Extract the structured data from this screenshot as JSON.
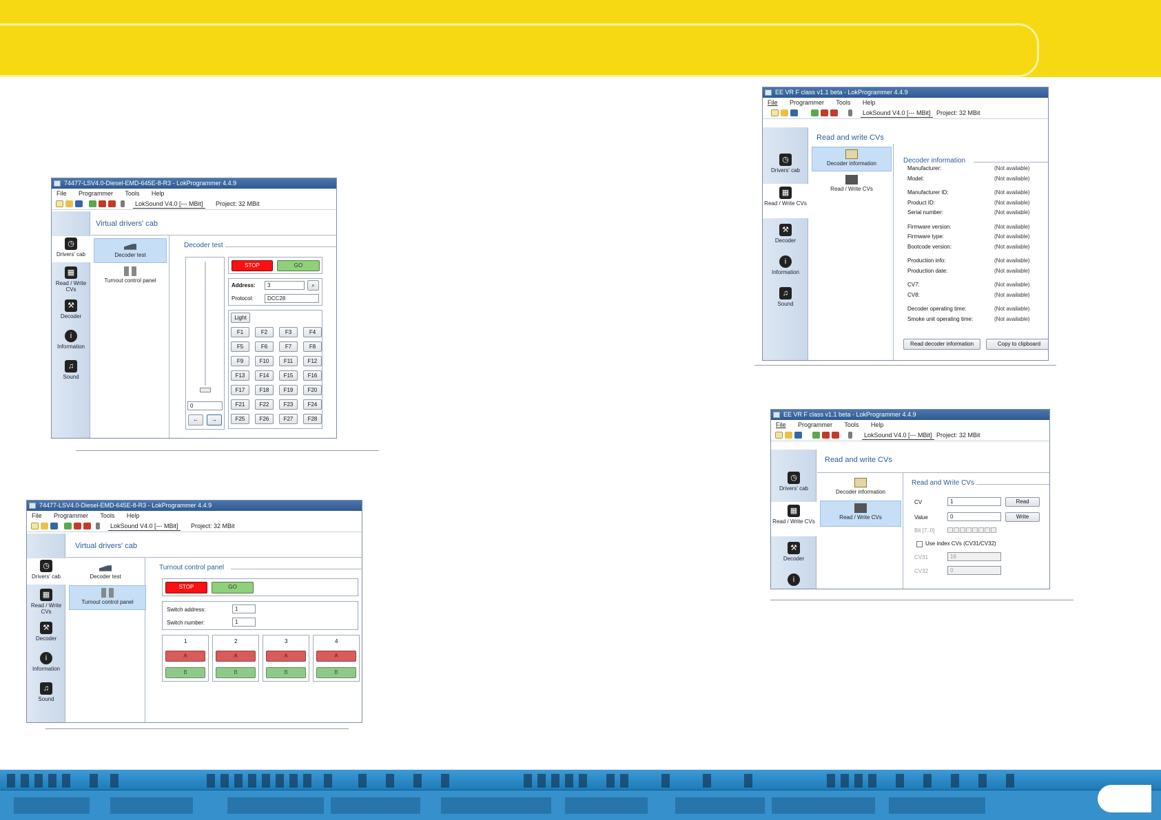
{
  "colors": {
    "banner": "#f6d912",
    "footer": "#2a86c2",
    "titlebar": "#3a659c",
    "stop": "#ff1010",
    "go": "#8fd07a"
  },
  "common": {
    "menu": [
      "File",
      "Programmer",
      "Tools",
      "Help"
    ],
    "decoder_combo": "LokSound V4.0 [--- MBit]",
    "project": "Project:  32 MBit",
    "nav": {
      "drivers_cab": "Drivers' cab",
      "read_write": "Read / Write CVs",
      "decoder": "Decoder",
      "information": "Information",
      "sound": "Sound"
    },
    "icons": [
      "new-icon",
      "open-icon",
      "save-icon",
      "read-icon",
      "write-icon",
      "play-icon",
      "wand-icon",
      "stopwatch-icon",
      "chip-icon",
      "wrench-icon",
      "info-icon",
      "music-icon",
      "train-icon",
      "turnout-icon",
      "id-card-icon"
    ]
  },
  "win1": {
    "title": "74477-LSV4.0-Diesel-EMD-645E-8-R3 - LokProgrammer 4.4.9",
    "header": "Virtual drivers' cab",
    "list": [
      "Decoder test",
      "Turnout control panel"
    ],
    "panel_title": "Decoder test",
    "stop": "STOP",
    "go": "GO",
    "address_label": "Address:",
    "address_value": "3",
    "protocol_label": "Protocol:",
    "protocol_value": "DCC28",
    "speed_value": "0",
    "light": "Light",
    "fkeys": [
      "F1",
      "F2",
      "F3",
      "F4",
      "F5",
      "F6",
      "F7",
      "F8",
      "F9",
      "F10",
      "F11",
      "F12",
      "F13",
      "F14",
      "F15",
      "F16",
      "F17",
      "F18",
      "F19",
      "F20",
      "F21",
      "F22",
      "F23",
      "F24",
      "F25",
      "F26",
      "F27",
      "F28"
    ]
  },
  "win2": {
    "title": "74477-LSV4.0-Diesel-EMD-645E-8-R3 - LokProgrammer 4.4.9",
    "header": "Virtual drivers' cab",
    "list": [
      "Decoder test",
      "Turnout control panel"
    ],
    "panel_title": "Turnout control panel",
    "stop": "STOP",
    "go": "GO",
    "switch_address_label": "Switch address:",
    "switch_address_value": "1",
    "switch_number_label": "Switch number:",
    "switch_number_value": "1",
    "switches": [
      "1",
      "2",
      "3",
      "4"
    ],
    "a": "A",
    "b": "B"
  },
  "win3": {
    "title": "EE VR F class v1.1 beta - LokProgrammer 4.4.9",
    "header": "Read and write CVs",
    "list": [
      "Decoder information",
      "Read / Write CVs"
    ],
    "panel_title": "Decoder information",
    "fields": [
      {
        "k": "Manufacturer:",
        "v": "(Not available)"
      },
      {
        "k": "Model:",
        "v": "(Not available)"
      },
      {
        "k": "Manufacturer ID:",
        "v": "(Not available)"
      },
      {
        "k": "Product ID:",
        "v": "(Not available)"
      },
      {
        "k": "Serial number:",
        "v": "(Not available)"
      },
      {
        "k": "Firmware version:",
        "v": "(Not available)"
      },
      {
        "k": "Firmware type:",
        "v": "(Not available)"
      },
      {
        "k": "Bootcode version:",
        "v": "(Not available)"
      },
      {
        "k": "Production info:",
        "v": "(Not available)"
      },
      {
        "k": "Production date:",
        "v": "(Not available)"
      },
      {
        "k": "CV7:",
        "v": "(Not available)"
      },
      {
        "k": "CV8:",
        "v": "(Not available)"
      },
      {
        "k": "Decoder operating time:",
        "v": "(Not available)"
      },
      {
        "k": "Smoke unit operating time:",
        "v": "(Not available)"
      }
    ],
    "read_button": "Read decoder information",
    "copy_button": "Copy to clipboard"
  },
  "win4": {
    "title": "EE VR F class v1.1 beta - LokProgrammer 4.4.9",
    "header": "Read and write CVs",
    "list": [
      "Decoder information",
      "Read / Write CVs"
    ],
    "panel_title": "Read and Write CVs",
    "cv_label": "CV",
    "cv_value": "1",
    "value_label": "Value",
    "value_value": "0",
    "bit_label": "Bit [7..0]",
    "read": "Read",
    "write": "Write",
    "use_index": "Use index CVs (CV31/CV32)",
    "cv31_label": "CV31",
    "cv31_value": "16",
    "cv32_label": "CV32",
    "cv32_value": "0"
  }
}
